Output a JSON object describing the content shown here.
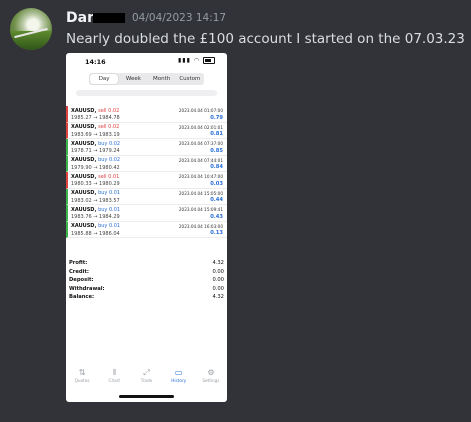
{
  "post": {
    "username": "Dan",
    "timestamp": "04/04/2023 14:17",
    "message": "Nearly doubled the £100 account I started on the 07.03.23"
  },
  "phone": {
    "status_time": "14:16",
    "segments": [
      "Day",
      "Week",
      "Month",
      "Custom"
    ],
    "active_segment": "Day",
    "trades": [
      {
        "symbol": "XAUUSD,",
        "side": "sell",
        "side_label": "sell 0.02",
        "datetime": "2023.04.04 01:07:00",
        "prices": "1985.27 → 1984.78",
        "profit": "0.79"
      },
      {
        "symbol": "XAUUSD,",
        "side": "sell",
        "side_label": "sell 0.02",
        "datetime": "2023.04.04 02:01:01",
        "prices": "1983.69 → 1983.19",
        "profit": "0.81"
      },
      {
        "symbol": "XAUUSD,",
        "side": "buy",
        "side_label": "buy 0.02",
        "datetime": "2023.04.04 07:37:00",
        "prices": "1978.71 → 1979.24",
        "profit": "0.85"
      },
      {
        "symbol": "XAUUSD,",
        "side": "buy",
        "side_label": "buy 0.02",
        "datetime": "2023.04.04 07:44:01",
        "prices": "1979.90 → 1980.42",
        "profit": "0.84"
      },
      {
        "symbol": "XAUUSD,",
        "side": "sell",
        "side_label": "sell 0.01",
        "datetime": "2023.04.04 10:47:00",
        "prices": "1980.33 → 1980.29",
        "profit": "0.03"
      },
      {
        "symbol": "XAUUSD,",
        "side": "buy",
        "side_label": "buy 0.01",
        "datetime": "2023.04.04 15:05:00",
        "prices": "1983.02 → 1983.57",
        "profit": "0.44"
      },
      {
        "symbol": "XAUUSD,",
        "side": "buy",
        "side_label": "buy 0.01",
        "datetime": "2023.04.04 15:09:41",
        "prices": "1983.76 → 1984.29",
        "profit": "0.43"
      },
      {
        "symbol": "XAUUSD,",
        "side": "buy",
        "side_label": "buy 0.01",
        "datetime": "2023.04.04 16:03:00",
        "prices": "1985.88 → 1986.04",
        "profit": "0.13"
      }
    ],
    "summary": [
      {
        "label": "Profit:",
        "value": "4.32"
      },
      {
        "label": "Credit:",
        "value": "0.00"
      },
      {
        "label": "Deposit:",
        "value": "0.00"
      },
      {
        "label": "Withdrawal:",
        "value": "0.00"
      },
      {
        "label": "Balance:",
        "value": "4.32"
      }
    ],
    "tabs": [
      {
        "label": "Quotes",
        "icon": "quotes-icon",
        "glyph": "⇅"
      },
      {
        "label": "Chart",
        "icon": "chart-icon",
        "glyph": "⫴"
      },
      {
        "label": "Trade",
        "icon": "trade-icon",
        "glyph": "⤢"
      },
      {
        "label": "History",
        "icon": "history-icon",
        "glyph": "▭"
      },
      {
        "label": "Settings",
        "icon": "settings-icon",
        "glyph": "⚙"
      }
    ],
    "active_tab": "History"
  },
  "colors": {
    "background": "#313338",
    "buy": "#2a6fd6",
    "sell": "#e0423d",
    "accent": "#2a6fd6"
  }
}
